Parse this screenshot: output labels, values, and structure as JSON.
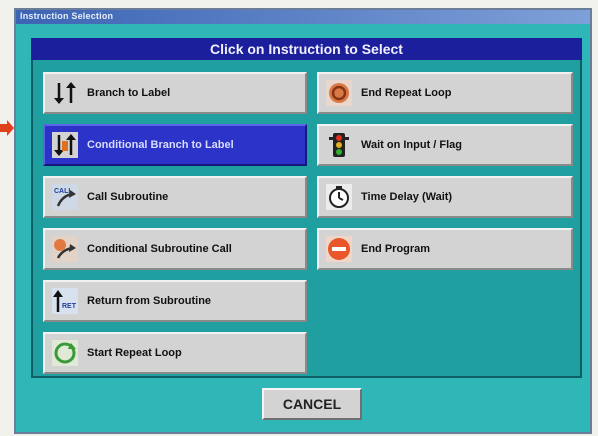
{
  "window": {
    "title": "Instruction Selection"
  },
  "header": {
    "title": "Click on Instruction to Select"
  },
  "left_buttons": [
    {
      "label": "Branch to Label",
      "icon": "branch-arrows-icon"
    },
    {
      "label": "Conditional Branch to Label",
      "icon": "conditional-branch-icon"
    },
    {
      "label": "Call Subroutine",
      "icon": "call-subroutine-icon"
    },
    {
      "label": "Conditional Subroutine Call",
      "icon": "conditional-call-icon"
    },
    {
      "label": "Return from Subroutine",
      "icon": "return-icon"
    },
    {
      "label": "Start Repeat Loop",
      "icon": "start-loop-icon"
    }
  ],
  "right_buttons": [
    {
      "label": "End Repeat Loop",
      "icon": "end-loop-icon"
    },
    {
      "label": "Wait on Input / Flag",
      "icon": "traffic-light-icon"
    },
    {
      "label": "Time Delay (Wait)",
      "icon": "clock-icon"
    },
    {
      "label": "End Program",
      "icon": "stop-icon"
    }
  ],
  "selected": "Conditional Branch to Label",
  "cancel_label": "CANCEL",
  "colors": {
    "dialog_bg": "#2fb7b7",
    "header_bg": "#1c1f9c",
    "selected_bg": "#2b33c9",
    "button_bg": "#d3d3d3",
    "pointer_arrow": "#e0401e"
  }
}
